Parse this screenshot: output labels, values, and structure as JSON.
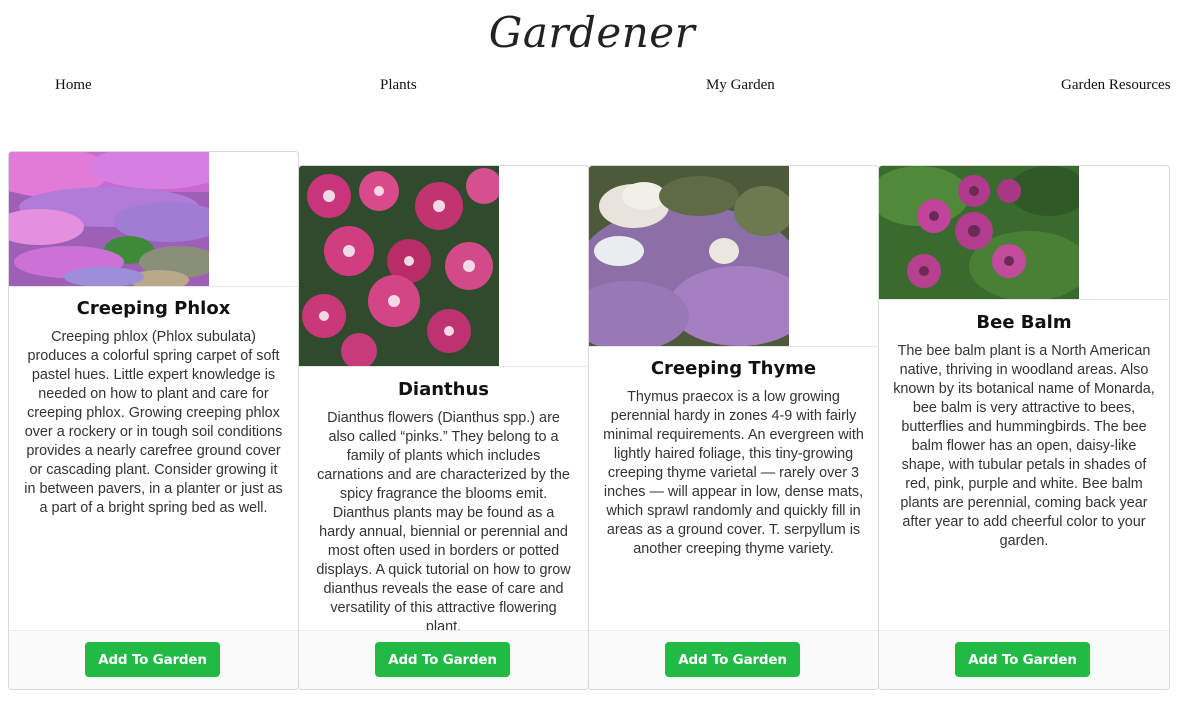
{
  "header": {
    "title": "Gardener"
  },
  "nav": {
    "items": [
      {
        "label": "Home"
      },
      {
        "label": "Plants"
      },
      {
        "label": "My Garden"
      },
      {
        "label": "Garden Resources"
      }
    ]
  },
  "plants": [
    {
      "name": "Creeping Phlox",
      "description": "Creeping phlox (Phlox subulata) produces a colorful spring carpet of soft pastel hues. Little expert knowledge is needed on how to plant and care for creeping phlox. Growing creeping phlox over a rockery or in tough soil conditions provides a nearly carefree ground cover or cascading plant. Consider growing it in between pavers, in a planter or just as a part of a bright spring bed as well.",
      "button_label": "Add To Garden"
    },
    {
      "name": "Dianthus",
      "description": "Dianthus flowers (Dianthus spp.) are also called “pinks.” They belong to a family of plants which includes carnations and are characterized by the spicy fragrance the blooms emit. Dianthus plants may be found as a hardy annual, biennial or perennial and most often used in borders or potted displays. A quick tutorial on how to grow dianthus reveals the ease of care and versatility of this attractive flowering plant.",
      "button_label": "Add To Garden"
    },
    {
      "name": "Creeping Thyme",
      "description": "Thymus praecox is a low growing perennial hardy in zones 4-9 with fairly minimal requirements. An evergreen with lightly haired foliage, this tiny-growing creeping thyme varietal — rarely over 3 inches — will appear in low, dense mats, which sprawl randomly and quickly fill in areas as a ground cover. T. serpyllum is another creeping thyme variety.",
      "button_label": "Add To Garden"
    },
    {
      "name": "Bee Balm",
      "description": "The bee balm plant is a North American native, thriving in woodland areas. Also known by its botanical name of Monarda, bee balm is very attractive to bees, butterflies and hummingbirds. The bee balm flower has an open, daisy-like shape, with tubular petals in shades of red, pink, purple and white. Bee balm plants are perennial, coming back year after year to add cheerful color to your garden.",
      "button_label": "Add To Garden"
    }
  ],
  "colors": {
    "button_bg": "#21ba45",
    "button_text": "#ffffff",
    "card_border": "#d9d9d9"
  }
}
